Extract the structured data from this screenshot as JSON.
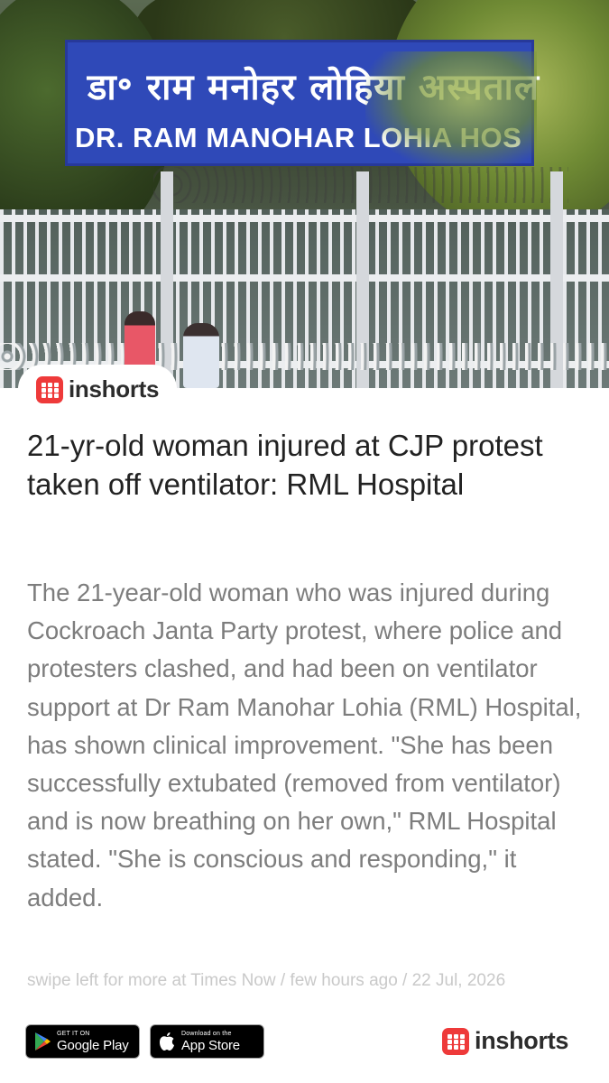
{
  "hero": {
    "sign_hindi": "डा॰ राम मनोहर लोहिया अस्पताल",
    "sign_english": "DR. RAM MANOHAR LOHIA HOS",
    "icon": "hospital-entrance-photo"
  },
  "brand": {
    "name": "inshorts",
    "accent_color": "#ee3a3a",
    "icon": "inshorts-logo-icon"
  },
  "article": {
    "headline": "21-yr-old woman injured at CJP protest taken off ventilator: RML Hospital",
    "body": "The 21-year-old woman who was injured during Cockroach Janta Party protest, where police and protesters clashed, and had been on ventilator support at Dr Ram Manohar Lohia (RML) Hospital, has shown clinical improvement. \"She has been successfully extubated (removed from ventilator) and is now breathing on her own,\" RML Hospital stated. \"She is conscious and responding,\" it added.",
    "meta": "swipe left for more at Times Now / few hours ago / 22 Jul, 2026"
  },
  "footer": {
    "google_play_small": "GET IT ON",
    "google_play_big": "Google Play",
    "app_store_small": "Download on the",
    "app_store_big": "App Store"
  }
}
